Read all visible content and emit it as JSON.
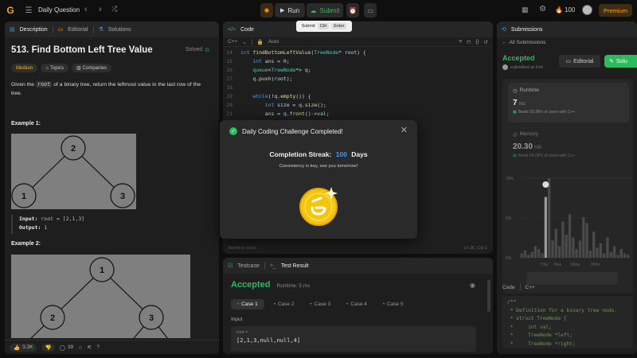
{
  "app": {
    "title": "Daily Question",
    "premium": "Premium",
    "points": "100"
  },
  "toolbar": {
    "run": "Run",
    "submit": "Submit"
  },
  "tooltip": {
    "label": "Submit",
    "key1": "Ctrl",
    "key2": "Enter"
  },
  "left": {
    "tabs": [
      "Description",
      "Editorial",
      "Solutions"
    ],
    "title": "513. Find Bottom Left Tree Value",
    "solved": "Solved",
    "tags": [
      "Medium",
      "Topics",
      "Companies"
    ],
    "desc_pre": "Given the ",
    "desc_code": "root",
    "desc_post": " of a binary tree, return the leftmost value in the last row of the tree.",
    "ex1": "Example 1:",
    "ex1_input_label": "Input:",
    "ex1_input": " root = [2,1,3]",
    "ex1_output_label": "Output:",
    "ex1_output": " 1",
    "ex2": "Example 2:",
    "tree1": {
      "root": "2",
      "left": "1",
      "right": "3"
    },
    "tree2": {
      "root": "1",
      "left": "2",
      "right": "3"
    },
    "likes": "3.3K",
    "comments": "39"
  },
  "code": {
    "tab": "Code",
    "lang": "C++",
    "auto": "Auto",
    "lines": [
      {
        "n": "14",
        "t": [
          [
            "kw",
            "int "
          ],
          [
            "fn",
            "findBottomLeftValue"
          ],
          [
            "pl",
            "("
          ],
          [
            "ty",
            "TreeNode"
          ],
          [
            "pl",
            "* "
          ],
          [
            "vr",
            "root"
          ],
          [
            "pl",
            ") {"
          ]
        ]
      },
      {
        "n": "15",
        "t": [
          [
            "pl",
            "    "
          ],
          [
            "kw",
            "int "
          ],
          [
            "vr",
            "ans"
          ],
          [
            "pl",
            " = "
          ],
          [
            "nm",
            "0"
          ],
          [
            "pl",
            ";"
          ]
        ]
      },
      {
        "n": "16",
        "t": [
          [
            "pl",
            "    "
          ],
          [
            "ty",
            "queue"
          ],
          [
            "pl",
            "<"
          ],
          [
            "ty",
            "TreeNode"
          ],
          [
            "pl",
            "*> "
          ],
          [
            "vr",
            "q"
          ],
          [
            "pl",
            ";"
          ]
        ]
      },
      {
        "n": "17",
        "t": [
          [
            "pl",
            "    "
          ],
          [
            "vr",
            "q"
          ],
          [
            "pl",
            "."
          ],
          [
            "fn",
            "push"
          ],
          [
            "pl",
            "("
          ],
          [
            "vr",
            "root"
          ],
          [
            "pl",
            "); "
          ]
        ]
      },
      {
        "n": "18",
        "t": [
          [
            "pl",
            ""
          ]
        ]
      },
      {
        "n": "19",
        "t": [
          [
            "pl",
            "    "
          ],
          [
            "kw",
            "while"
          ],
          [
            "pl",
            "(!"
          ],
          [
            "vr",
            "q"
          ],
          [
            "pl",
            "."
          ],
          [
            "fn",
            "empty"
          ],
          [
            "pl",
            "()) {"
          ]
        ]
      },
      {
        "n": "20",
        "t": [
          [
            "pl",
            "        "
          ],
          [
            "kw",
            "int "
          ],
          [
            "vr",
            "size"
          ],
          [
            "pl",
            " = "
          ],
          [
            "vr",
            "q"
          ],
          [
            "pl",
            "."
          ],
          [
            "fn",
            "size"
          ],
          [
            "pl",
            "();"
          ]
        ]
      },
      {
        "n": "21",
        "t": [
          [
            "pl",
            "        "
          ],
          [
            "vr",
            "ans"
          ],
          [
            "pl",
            " = "
          ],
          [
            "vr",
            "q"
          ],
          [
            "pl",
            "."
          ],
          [
            "fn",
            "front"
          ],
          [
            "pl",
            "()->"
          ],
          [
            "vr",
            "val"
          ],
          [
            "pl",
            ";"
          ]
        ]
      },
      {
        "n": "22",
        "t": [
          [
            "pl",
            ""
          ]
        ]
      },
      {
        "n": "23",
        "t": [
          [
            "pl",
            "        "
          ],
          [
            "kw",
            "for"
          ],
          [
            "pl",
            "("
          ],
          [
            "kw",
            "int "
          ],
          [
            "vr",
            "i"
          ],
          [
            "pl",
            "="
          ],
          [
            "nm",
            "0"
          ],
          [
            "pl",
            "; i<size; i++) {"
          ]
        ]
      }
    ],
    "saved": "Saved to local",
    "cursor": "Ln 26, Col 1"
  },
  "modal": {
    "title": "Daily Coding Challenge Completed!",
    "streak_label": "Completion Streak:",
    "streak_num": "100",
    "streak_unit": "Days",
    "sub": "Consistency is key, see you tomorrow!"
  },
  "result": {
    "tabs": [
      "Testcase",
      "Test Result"
    ],
    "status": "Accepted",
    "runtime": "Runtime: 5 ms",
    "cases": [
      "Case 1",
      "Case 2",
      "Case 3",
      "Case 4",
      "Case 5"
    ],
    "input_label": "Input",
    "var": "root =",
    "value": "[2,1,3,null,null,4]"
  },
  "subs": {
    "tab": "Submissions",
    "all": "All Submissions",
    "status": "Accepted",
    "by": "submitted at Feb",
    "editorial": "Editorial",
    "solution": "Solu",
    "runtime_label": "Runtime",
    "runtime_val": "7",
    "runtime_unit": "ms",
    "beats_r": "Beats 59.38% of users with C++",
    "memory_label": "Memory",
    "memory_val": "20.30",
    "memory_unit": "MB",
    "beats_m": "Beats 64.02% of users with C++",
    "y_ticks": [
      "10%",
      "5%",
      "0%"
    ],
    "x_ticks": [
      "7ms",
      "6ms",
      "10ms",
      "15ms"
    ],
    "code_label": "Code",
    "code_lang": "C++",
    "code_lines": [
      "/**",
      " * Definition for a binary tree node.",
      " * struct TreeNode {",
      " *     int val;",
      " *     TreeNode *left;",
      " *     TreeNode *right;"
    ],
    "hist": [
      3,
      5,
      2,
      4,
      8,
      6,
      3,
      42,
      55,
      12,
      20,
      8,
      25,
      16,
      30,
      14,
      6,
      12,
      28,
      24,
      5,
      18,
      7,
      10,
      3,
      14,
      4,
      8,
      2,
      6,
      3,
      2
    ]
  }
}
